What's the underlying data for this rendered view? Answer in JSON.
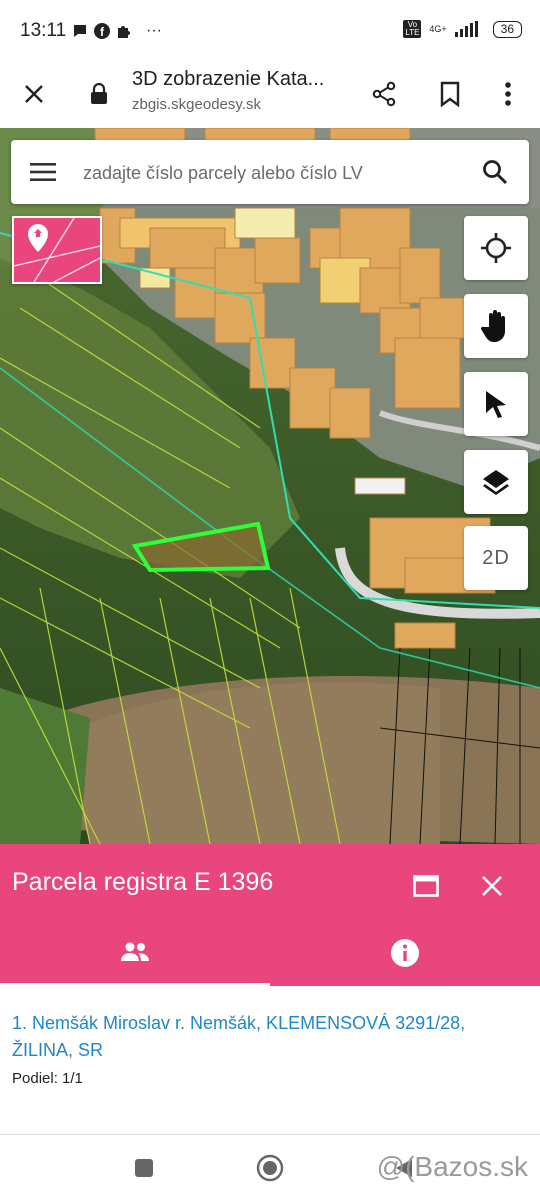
{
  "status_bar": {
    "time": "13:11",
    "more": "···",
    "network": "4G+",
    "volte": "Vo LTE",
    "battery": "36"
  },
  "browser": {
    "title": "3D zobrazenie Kata...",
    "url": "zbgis.skgeodesy.sk",
    "icons": [
      "close-icon",
      "lock-icon",
      "share-icon",
      "bookmark-icon",
      "more-vert-icon"
    ]
  },
  "map": {
    "search_placeholder": "zadajte číslo parcely alebo číslo LV",
    "tool_2d_label": "2D",
    "tools": [
      "locate-icon",
      "hand-icon",
      "pointer-icon",
      "layers-icon"
    ]
  },
  "panel": {
    "title": "Parcela registra E 1396",
    "tabs": [
      {
        "icon": "people-icon",
        "active": true
      },
      {
        "icon": "info-icon",
        "active": false
      }
    ],
    "owner": "1. Nemšák Miroslav r. Nemšák, KLEMENSOVÁ 3291/28, ŽILINA, SR",
    "share": "Podiel: 1/1",
    "colors": {
      "accent": "#e8467c",
      "link": "#1e88c7"
    }
  },
  "navbar": {
    "watermark": "@(Bazos.sk"
  }
}
